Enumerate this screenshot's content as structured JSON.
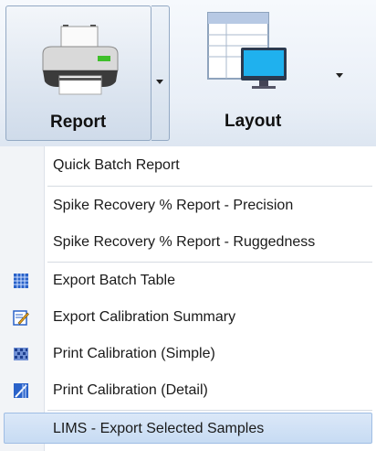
{
  "ribbon": {
    "report_label": "Report",
    "layout_label": "Layout"
  },
  "menu": {
    "items": [
      {
        "label": "Quick Batch Report",
        "icon": "none"
      },
      {
        "label": "Spike Recovery % Report - Precision",
        "icon": "none"
      },
      {
        "label": "Spike Recovery % Report - Ruggedness",
        "icon": "none"
      },
      {
        "label": "Export Batch Table",
        "icon": "table-grid-icon"
      },
      {
        "label": "Export Calibration Summary",
        "icon": "calibration-summary-icon"
      },
      {
        "label": "Print Calibration (Simple)",
        "icon": "calibration-grid-icon"
      },
      {
        "label": "Print Calibration (Detail)",
        "icon": "calibration-detail-icon"
      },
      {
        "label": "LIMS - Export Selected Samples",
        "icon": "none",
        "selected": true
      }
    ]
  },
  "colors": {
    "highlight": "#c7dbf3",
    "icon_blue": "#2a62c9"
  }
}
